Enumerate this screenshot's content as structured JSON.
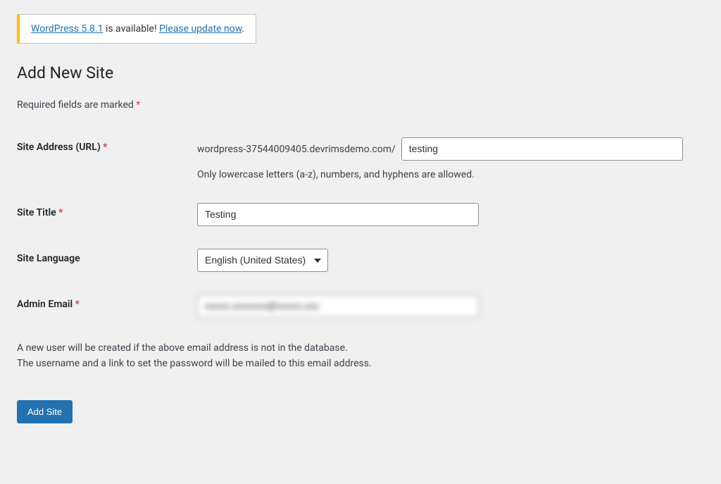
{
  "notice": {
    "link1": "WordPress 5.8.1",
    "text_mid": " is available! ",
    "link2": "Please update now",
    "text_end": "."
  },
  "page": {
    "title": "Add New Site",
    "required_note": "Required fields are marked ",
    "asterisk": "*"
  },
  "fields": {
    "url": {
      "label": "Site Address (URL) ",
      "domain": "wordpress-37544009405.devrimsdemo.com/",
      "value": "testing",
      "description": "Only lowercase letters (a-z), numbers, and hyphens are allowed."
    },
    "title": {
      "label": "Site Title ",
      "value": "Testing"
    },
    "language": {
      "label": "Site Language",
      "value": "English (United States)"
    },
    "email": {
      "label": "Admin Email ",
      "value": "xxxxx.xxxxxxx@xxxxx.xxx"
    }
  },
  "info": {
    "line1": "A new user will be created if the above email address is not in the database.",
    "line2": "The username and a link to set the password will be mailed to this email address."
  },
  "actions": {
    "submit": "Add Site"
  }
}
